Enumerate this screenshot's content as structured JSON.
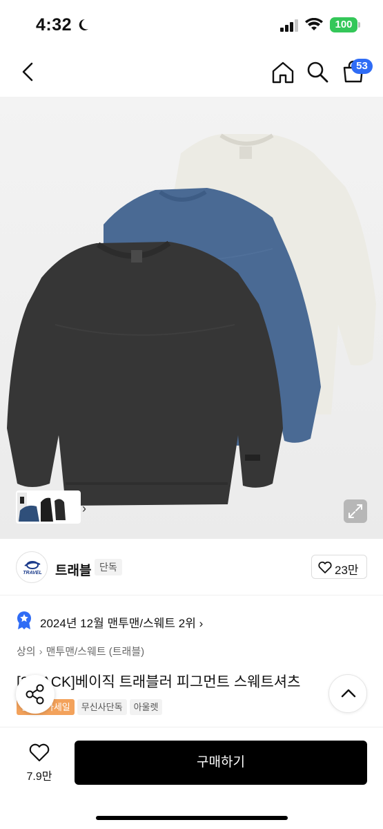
{
  "status_bar": {
    "time": "4:32",
    "battery": "100"
  },
  "header": {
    "cart_count": "53"
  },
  "brand": {
    "name": "트래블",
    "tag": "단독",
    "logo_text": "TRAVEL",
    "likes": "23만"
  },
  "ranking": {
    "text": "2024년 12월 맨투맨/스웨트 2위"
  },
  "breadcrumb": [
    "상의",
    "맨투맨/스웨트 (트래블)"
  ],
  "product": {
    "title": "[3 PACK]베이직 트래블러 피그먼트 스웨트셔츠",
    "tags": [
      "연말특가세일",
      "무신사단독",
      "아울렛"
    ]
  },
  "bottom_bar": {
    "wish_count": "7.9만",
    "buy_label": "구매하기"
  },
  "colors": {
    "accent_blue": "#2f6cf5",
    "battery_green": "#34c759",
    "tag_orange": "#f3a25b",
    "buy_button": "#000000"
  }
}
